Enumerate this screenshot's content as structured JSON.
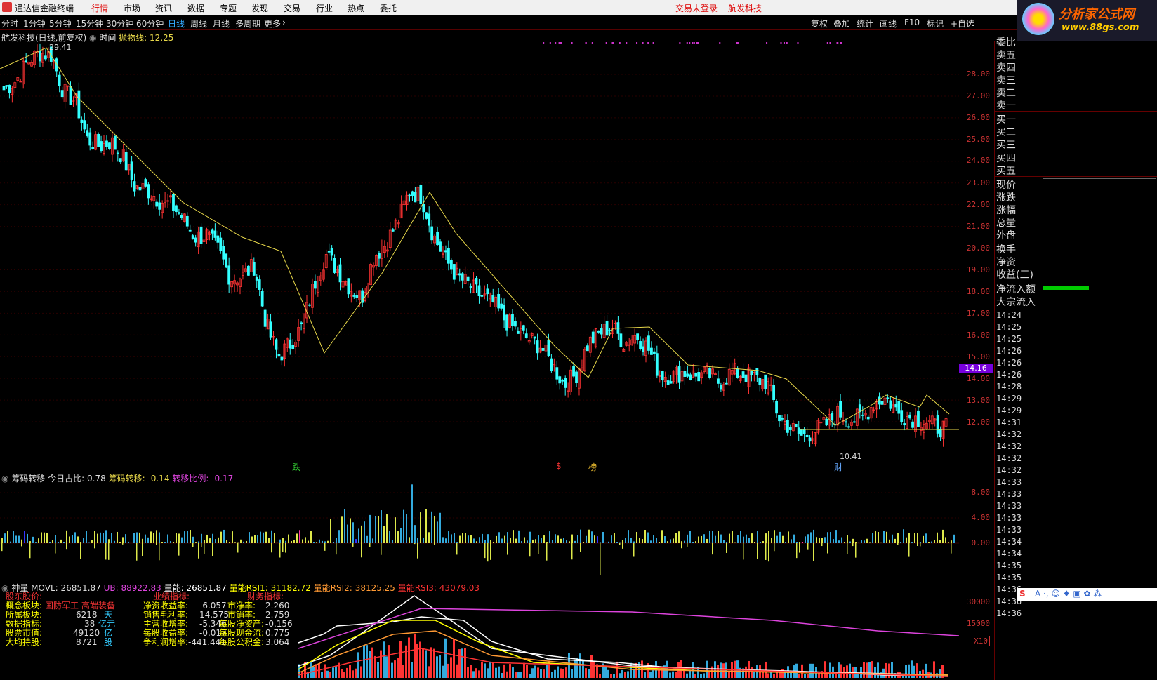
{
  "menu": {
    "app_name": "通达信金融终端",
    "items": [
      "行情",
      "市场",
      "资讯",
      "数据",
      "专题",
      "发现",
      "交易",
      "行业",
      "热点",
      "委托"
    ],
    "active": "行情",
    "right_items": [
      "交易未登录",
      "航发科技"
    ]
  },
  "toolbar": {
    "periods": [
      "分时",
      "1分钟",
      "5分钟",
      "15分钟",
      "30分钟",
      "60分钟",
      "日线",
      "周线",
      "月线",
      "多周期",
      "更多"
    ],
    "active": "日线",
    "right_buttons": [
      "复权",
      "叠加",
      "统计",
      "画线",
      "F10",
      "标记",
      "+自选"
    ]
  },
  "brand": {
    "title": "分析家公式网",
    "url": "www.88gs.com"
  },
  "chart_header": {
    "stock": "航发科技(日线,前复权)",
    "time_label": "时间",
    "indicator": "抛物线:",
    "indicator_value": "12.25"
  },
  "main_chart": {
    "high_label": "29.41",
    "low_label": "10.41",
    "current_price": "14.16",
    "y_ticks": [
      "28.00",
      "27.00",
      "26.00",
      "25.00",
      "24.00",
      "23.00",
      "22.00",
      "21.00",
      "20.00",
      "19.00",
      "18.00",
      "17.00",
      "16.00",
      "15.00",
      "14.00",
      "13.00",
      "12.00"
    ],
    "markers": [
      {
        "text": "跌",
        "color": "#3c3"
      },
      {
        "text": "$",
        "color": "#e33"
      },
      {
        "text": "榜",
        "color": "#fc3"
      },
      {
        "text": "财",
        "color": "#6af"
      }
    ]
  },
  "chip_panel": {
    "title": "筹码转移",
    "today_ratio_label": "今日占比:",
    "today_ratio": "0.78",
    "transfer_label": "筹码转移:",
    "transfer": "-0.14",
    "ratio_label": "转移比例:",
    "ratio": "-0.17",
    "y_ticks": [
      "8.00",
      "4.00",
      "0.00"
    ]
  },
  "volume_panel": {
    "title": "神量",
    "movl_label": "MOVL:",
    "movl": "26851.87",
    "ub_label": "UB:",
    "ub": "88922.83",
    "vol_label": "量能:",
    "vol": "26851.87",
    "rsi1_label": "量能RSI1:",
    "rsi1": "31182.72",
    "rsi2_label": "量能RSI2:",
    "rsi2": "38125.25",
    "rsi3_label": "量能RSI3:",
    "rsi3": "43079.03",
    "y_ticks": [
      "30000",
      "15000"
    ],
    "multiplier": "X10"
  },
  "info_box": {
    "col1": [
      "股东股价:",
      "概念板块:",
      "所属板块:",
      "数据指标:",
      "股票市值:",
      "大均持股:"
    ],
    "col1_values": [
      "国防军工 高端装备",
      "6218",
      "38",
      "49120",
      "8721"
    ],
    "col1_units": [
      "天",
      "亿元",
      "亿",
      "股"
    ],
    "col2_title": "业绩指标:",
    "col2": [
      "净资收益率:",
      "销售毛利率:",
      "主营收增率:",
      "每股收益率:",
      "争利润增率:"
    ],
    "col2_values": [
      "-6.057",
      "14.575",
      "-5.346",
      "-0.017",
      "-441.441"
    ],
    "col3_title": "财务指标:",
    "col3": [
      "市净率:",
      "市销率:",
      "每股净资产:",
      "每股现金流:",
      "每股公积金:"
    ],
    "col3_values": [
      "2.260",
      "2.759",
      "-0.156",
      "0.775",
      "3.064"
    ]
  },
  "order_book": {
    "labels": [
      "委比",
      "卖五",
      "卖四",
      "卖三",
      "卖二",
      "卖一",
      "买一",
      "买二",
      "买三",
      "买四",
      "买五",
      "现价",
      "涨跌",
      "涨幅",
      "总量",
      "外盘",
      "换手",
      "净资",
      "收益(三)",
      "净流入额",
      "大宗流入"
    ]
  },
  "ticks": [
    "14:24",
    "14:25",
    "14:25",
    "14:26",
    "14:26",
    "14:26",
    "14:28",
    "14:29",
    "14:29",
    "14:31",
    "14:32",
    "14:32",
    "14:32",
    "14:32",
    "14:33",
    "14:33",
    "14:33",
    "14:33",
    "14:33",
    "14:34",
    "14:34",
    "14:35",
    "14:35",
    "14:36",
    "14:36",
    "14:36"
  ],
  "colors": {
    "up": "#ff3333",
    "down": "#33ffff",
    "sar": "#e8d84a",
    "axis": "#c33",
    "grid": "#300"
  },
  "chart_data": {
    "type": "candlestick",
    "series": [
      {
        "values": [
          27.3,
          27.7,
          28.6,
          29.0,
          28.9,
          27.2,
          26.8,
          25.0,
          24.7,
          24.9,
          24.2,
          22.8,
          22.7,
          22.2,
          22.0,
          21.4,
          20.5,
          20.6,
          19.9,
          18.6,
          18.7,
          19.2,
          16.5,
          15.0,
          15.6,
          16.4,
          18.3,
          19.7,
          19.0,
          18.2,
          17.7,
          19.6,
          20.2,
          21.2,
          22.6,
          22.4,
          20.6,
          19.5,
          18.7,
          18.3,
          17.8,
          17.5,
          16.7,
          16.2,
          15.8,
          15.5,
          14.6,
          13.7,
          14.2,
          15.6,
          16.1,
          16.4,
          15.6,
          16.0,
          15.4,
          14.2,
          14.1,
          14.3,
          14.1,
          14.2,
          13.8,
          14.3,
          14.2,
          14.0,
          13.8,
          12.2,
          11.7,
          11.3,
          11.6,
          11.9,
          12.4,
          12.1,
          12.2,
          12.9,
          13.1,
          12.4,
          12.2,
          12.1,
          11.8,
          11.7
        ]
      }
    ],
    "ylim": [
      10,
      29.8
    ],
    "ub_max": 30000
  }
}
